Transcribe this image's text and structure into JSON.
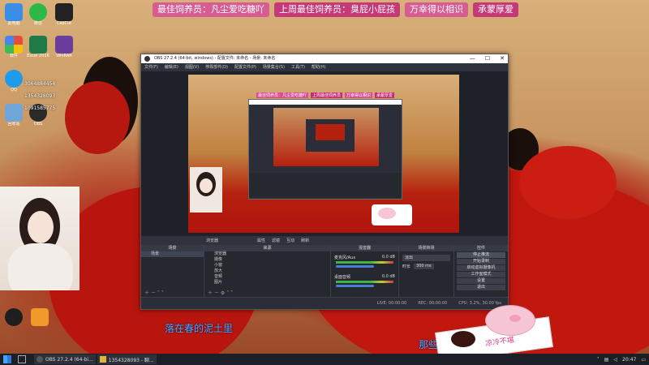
{
  "banner": [
    {
      "text": "最佳饲养员：凡尘爱吃糖吖"
    },
    {
      "text": "上周最佳饲养员：臭屁小屁孩"
    },
    {
      "text": "万幸得以相识"
    },
    {
      "text": "承蒙厚爱"
    }
  ],
  "desktop_icons": [
    {
      "label": "此电脑",
      "color": "#3a8ee6",
      "icon": "computer-icon"
    },
    {
      "label": "微信",
      "color": "#2db84a",
      "icon": "wechat-icon"
    },
    {
      "label": "CapCut",
      "color": "#222222",
      "icon": "capcut-icon"
    },
    {
      "label": "软件",
      "color": "#e94b3c",
      "icon": "app-icon"
    },
    {
      "label": "Excel 2016",
      "color": "#1f7a46",
      "icon": "excel-icon"
    },
    {
      "label": "WinRAR",
      "color": "#6b3e9e",
      "icon": "winrar-icon"
    },
    {
      "label": "QQ",
      "color": "#1e9bea",
      "icon": "qq-icon"
    },
    {
      "label": "回收站",
      "color": "#6fa6d6",
      "icon": "recycle-bin-icon"
    },
    {
      "label": "OBS",
      "color": "#2a2a2a",
      "icon": "obs-icon"
    }
  ],
  "overlay_numbers": [
    "3064884454",
    "1354328093",
    "1091585775"
  ],
  "webcam": {
    "label": "webcam"
  },
  "obs": {
    "title": "OBS 27.2.4 (64-bit, windows) - 配置文件: 未命名 - 场景: 未命名",
    "menu": [
      "文件(F)",
      "编辑(E)",
      "视图(V)",
      "停靠部件(D)",
      "配置文件(P)",
      "场景集合(S)",
      "工具(T)",
      "帮助(H)"
    ],
    "preview_banner": [
      "最佳饲养员：凡尘爱吃糖吖",
      "上周最佳饲养员",
      "万幸得以相识",
      "承蒙厚爱"
    ],
    "toolbar": {
      "source_label": "浏览器",
      "props": "属性",
      "filters": "滤镜",
      "interact": "互动",
      "refresh": "刷新"
    },
    "scenes": {
      "title": "场景",
      "items": [
        "场景"
      ]
    },
    "sources": {
      "title": "来源",
      "items": [
        "浏览器",
        "摄像",
        "小窗",
        "放大",
        "音频",
        "图片"
      ]
    },
    "mixer": {
      "title": "混音器",
      "channels": [
        {
          "name": "麦克风/Aux",
          "db": "0.0 dB"
        },
        {
          "name": "桌面音频",
          "db": "0.0 dB"
        }
      ]
    },
    "transitions": {
      "title": "场景转场",
      "type": "淡出",
      "duration_label": "时长",
      "duration": "300 ms"
    },
    "controls": {
      "title": "控件",
      "buttons": [
        "停止推流",
        "开始录制",
        "启动虚拟摄像机",
        "工作室模式",
        "设置",
        "退出"
      ]
    },
    "status": {
      "live": "LIVE: 00:00:00",
      "rec": "REC: 00:00:00",
      "cpu": "CPU: 3.2%, 30.00 fps"
    }
  },
  "subtitles": {
    "line1": "落在春的泥土里",
    "line2": "那些"
  },
  "pig_sticker": {
    "text": "凉冷不堪"
  },
  "taskbar": {
    "tasks": [
      {
        "label": "OBS 27.2.4 (64-bi...",
        "icon": "obs-icon"
      },
      {
        "label": "1354328093 - 聊...",
        "icon": "chat-icon"
      }
    ],
    "time": "20:47"
  },
  "colors": {
    "accent_pink": "#d64e96",
    "subtitle_blue": "#4aa8ff",
    "obs_bg": "#2b2e38"
  }
}
